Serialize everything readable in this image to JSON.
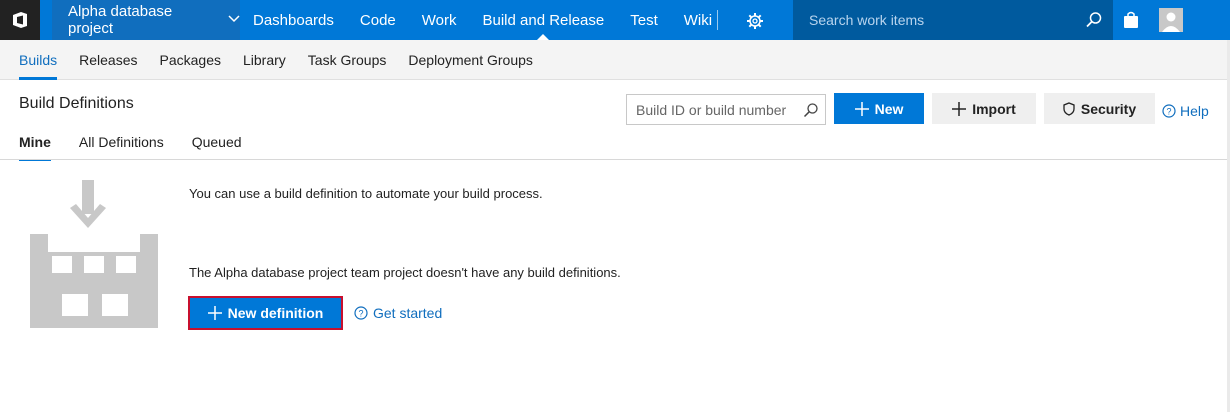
{
  "topbar": {
    "project_name": "Alpha database project",
    "nav": [
      "Dashboards",
      "Code",
      "Work",
      "Build and Release",
      "Test",
      "Wiki"
    ],
    "active_nav": "Build and Release",
    "search_placeholder": "Search work items",
    "accent": "#0078d7"
  },
  "subnav": {
    "items": [
      "Builds",
      "Releases",
      "Packages",
      "Library",
      "Task Groups",
      "Deployment Groups"
    ],
    "active": "Builds"
  },
  "header": {
    "title": "Build Definitions",
    "search_placeholder": "Build ID or build number",
    "new_label": "New",
    "import_label": "Import",
    "security_label": "Security",
    "help_label": "Help"
  },
  "tabs": {
    "items": [
      "Mine",
      "All Definitions",
      "Queued"
    ],
    "active": "Mine"
  },
  "empty_state": {
    "message1": "You can use a build definition to automate your build process.",
    "message2": "The Alpha database project team project doesn't have any build definitions.",
    "new_definition_label": "New definition",
    "get_started_label": "Get started",
    "highlight_color": "#c8102e"
  },
  "icons": [
    "vsts-logo-icon",
    "chevron-down-icon",
    "gear-icon",
    "search-icon",
    "bag-icon",
    "avatar-icon",
    "plus-icon",
    "shield-icon",
    "help-circle-icon",
    "build-illustration-icon"
  ]
}
